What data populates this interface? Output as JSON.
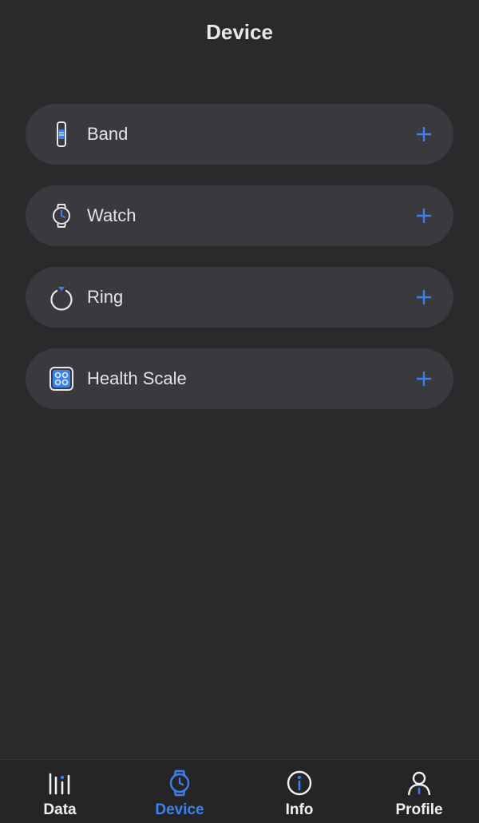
{
  "header": {
    "title": "Device"
  },
  "devices": [
    {
      "label": "Band",
      "icon": "band-icon"
    },
    {
      "label": "Watch",
      "icon": "watch-icon"
    },
    {
      "label": "Ring",
      "icon": "ring-icon"
    },
    {
      "label": "Health Scale",
      "icon": "scale-icon"
    }
  ],
  "add_icon": "plus-icon",
  "tabs": [
    {
      "label": "Data",
      "icon": "bar-chart-icon",
      "active": false
    },
    {
      "label": "Device",
      "icon": "watch-icon",
      "active": true
    },
    {
      "label": "Info",
      "icon": "info-icon",
      "active": false
    },
    {
      "label": "Profile",
      "icon": "person-icon",
      "active": false
    }
  ],
  "colors": {
    "background": "#2a2a2d",
    "card": "#3a393e",
    "accent": "#3b82f0",
    "text": "#e4e4e6",
    "tab_bar": "#252527"
  }
}
